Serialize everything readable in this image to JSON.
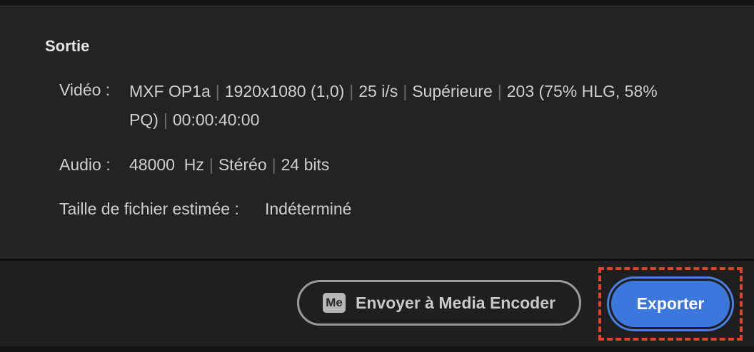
{
  "output": {
    "title": "Sortie",
    "video": {
      "label": "Vidéo :",
      "format": "MXF OP1a",
      "resolution": "1920x1080 (1,0)",
      "framerate": "25 i/s",
      "quality": "Supérieure",
      "hdr_line1": "203 (75% HLG, 58%",
      "hdr_line2": "PQ)",
      "duration": "00:00:40:00"
    },
    "audio": {
      "label": "Audio :",
      "rate": "48000  Hz",
      "channels": "Stéréo",
      "bits": "24 bits"
    },
    "filesize": {
      "label": "Taille de fichier estimée :",
      "value": "Indéterminé"
    }
  },
  "footer": {
    "encoder_icon_text": "Me",
    "encoder_button": "Envoyer à Media Encoder",
    "export_button": "Exporter"
  },
  "colors": {
    "accent": "#3c77dd",
    "highlight": "#e0452c"
  }
}
